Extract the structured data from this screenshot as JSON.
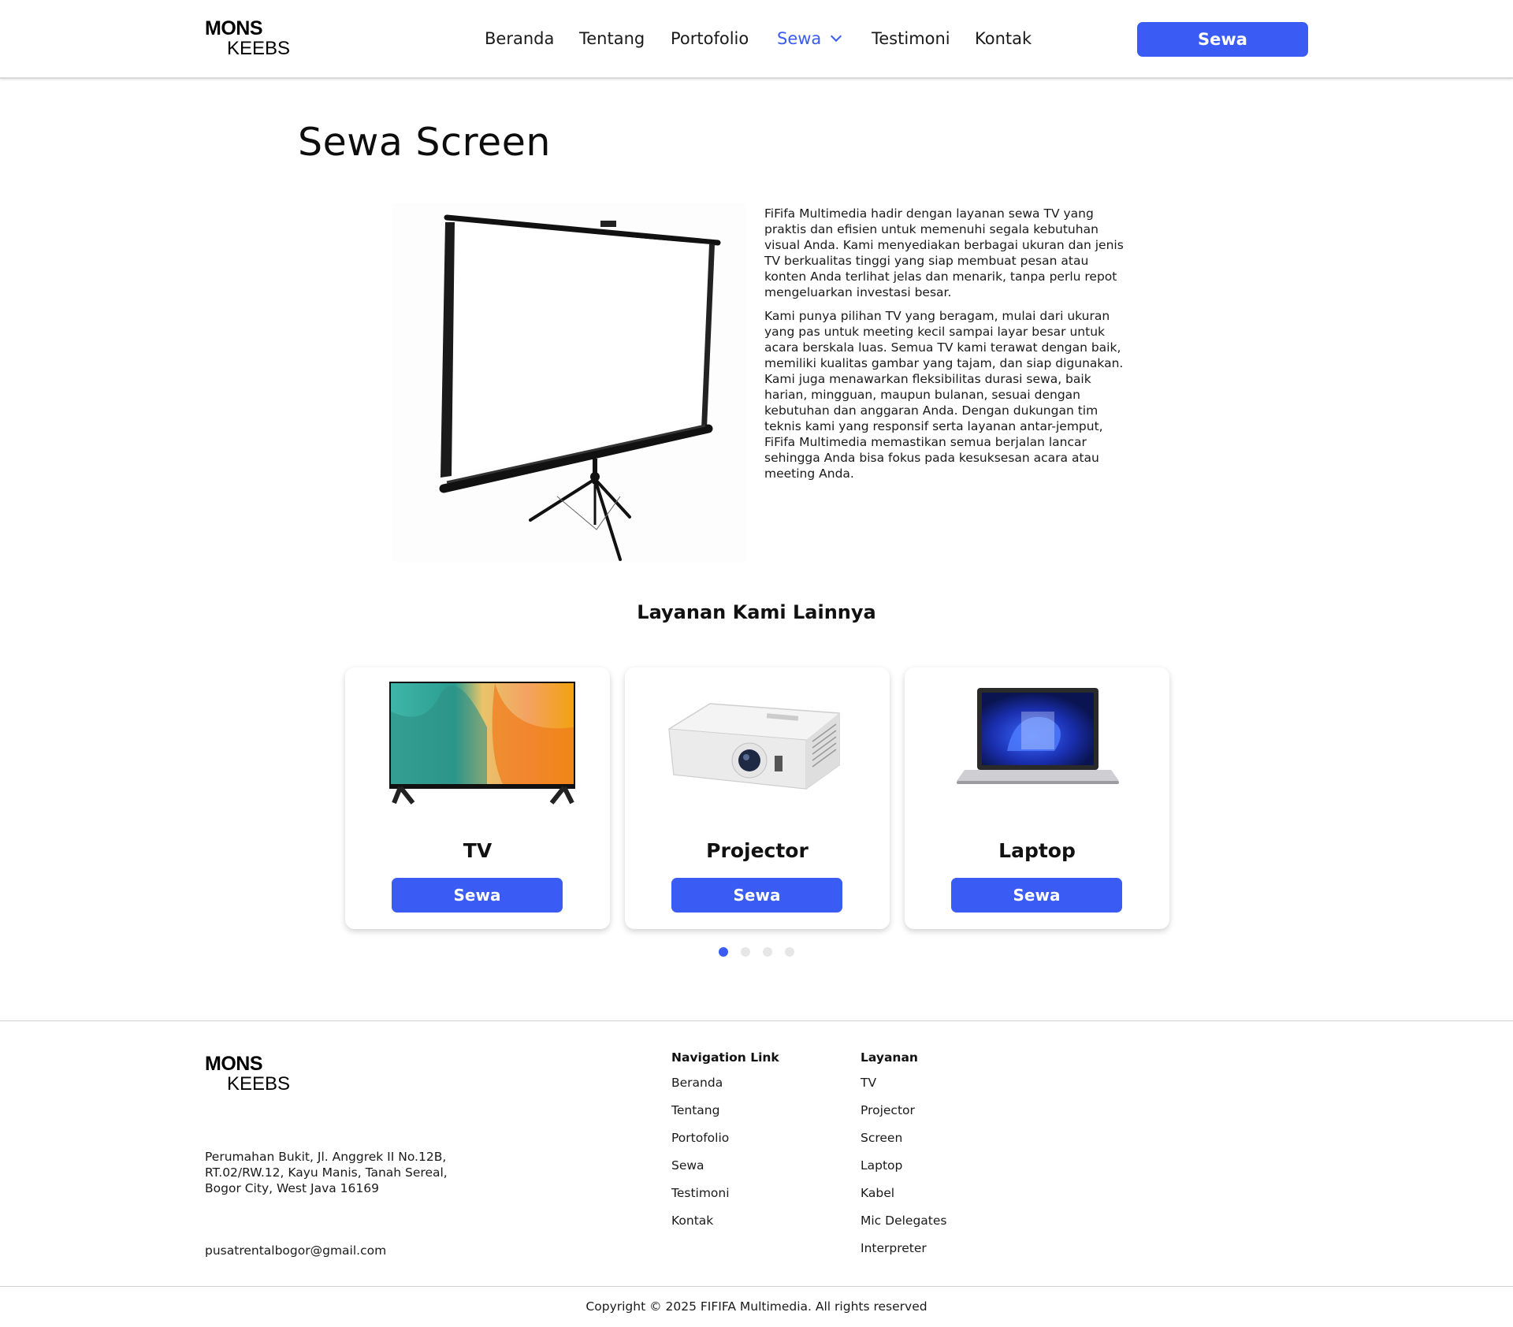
{
  "brand": {
    "line1": "MONS",
    "line2": "KEEBS"
  },
  "nav": {
    "links": [
      "Beranda",
      "Tentang",
      "Portofolio",
      "Sewa",
      "Testimoni",
      "Kontak"
    ],
    "active": "Sewa",
    "cta_label": "Sewa"
  },
  "colors": {
    "accent": "#3a5bf4"
  },
  "hero": {
    "title": "Sewa Screen",
    "image_icon": "projector-screen-icon",
    "paragraphs": [
      "FiFifa Multimedia hadir dengan layanan sewa TV yang praktis dan efisien untuk memenuhi segala kebutuhan visual Anda. Kami menyediakan berbagai ukuran dan jenis TV berkualitas tinggi yang siap membuat pesan atau konten Anda terlihat jelas dan menarik, tanpa perlu repot mengeluarkan investasi besar.",
      "Kami punya pilihan TV yang beragam, mulai dari ukuran yang pas untuk meeting kecil sampai layar besar untuk acara berskala luas. Semua TV kami terawat dengan baik, memiliki kualitas gambar yang tajam, dan siap digunakan. Kami juga menawarkan fleksibilitas durasi sewa, baik harian, mingguan, maupun bulanan, sesuai dengan kebutuhan dan anggaran Anda. Dengan dukungan tim teknis kami yang responsif serta layanan antar-jemput, FiFifa Multimedia memastikan semua berjalan lancar sehingga Anda bisa fokus pada kesuksesan acara atau meeting Anda."
    ]
  },
  "services": {
    "title": "Layanan Kami Lainnya",
    "cards": [
      {
        "title": "TV",
        "button": "Sewa",
        "icon": "tv-icon"
      },
      {
        "title": "Projector",
        "button": "Sewa",
        "icon": "projector-icon"
      },
      {
        "title": "Laptop",
        "button": "Sewa",
        "icon": "laptop-icon"
      }
    ],
    "pagination": {
      "total": 4,
      "current": 1
    }
  },
  "footer": {
    "address": [
      "Perumahan Bukit, Jl. Anggrek II No.12B,",
      "RT.02/RW.12, Kayu Manis, Tanah Sereal,",
      "Bogor City, West Java 16169"
    ],
    "email": "pusatrentalbogor@gmail.com",
    "nav_heading": "Navigation Link",
    "nav_links": [
      "Beranda",
      "Tentang",
      "Portofolio",
      "Sewa",
      "Testimoni",
      "Kontak"
    ],
    "services_heading": "Layanan",
    "services_links": [
      "TV",
      "Projector",
      "Screen",
      "Laptop",
      "Kabel",
      "Mic Delegates",
      "Interpreter"
    ],
    "copyright": "Copyright © 2025 FIFIFA Multimedia. All rights reserved"
  }
}
